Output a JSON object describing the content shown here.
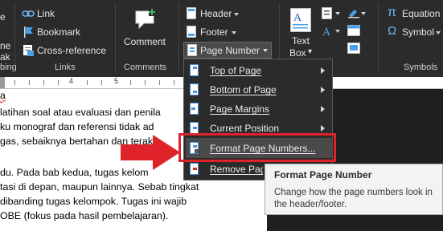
{
  "ribbon": {
    "links_group": {
      "items": [
        {
          "label": "Link",
          "icon": "link-icon"
        },
        {
          "label": "Bookmark",
          "icon": "bookmark-flag-icon"
        },
        {
          "label": "Cross-reference",
          "icon": "cross-reference-icon"
        }
      ],
      "group_label": "Links"
    },
    "comments_group": {
      "button_label": "Comment",
      "group_label": "Comments",
      "icon": "comment-icon"
    },
    "header_footer_group": {
      "header_label": "Header",
      "footer_label": "Footer",
      "page_number_label": "Page Number"
    },
    "text_group": {
      "text_box_label_line1": "Text",
      "text_box_label_line2": "Box",
      "caret": "▾"
    },
    "symbols_group": {
      "equation_label": "Equation",
      "symbol_label": "Symbol",
      "group_label": "Symbols",
      "equation_glyph": "π",
      "symbol_glyph": "Ω"
    },
    "left_cut_text": {
      "top": "e",
      "middle": "ne",
      "bottom": "ak"
    },
    "left_cut_label": "bing"
  },
  "ruler": {
    "marker_4": "4",
    "marker_5": "5"
  },
  "document": {
    "lines": [
      "a",
      "latihan soal atau evaluasi dan penila",
      "ku monograf dan referensi tidak ad",
      "gas, sebaiknya bertahan dan terak",
      "",
      "du. Pada bab kedua, tugas kelom",
      "tasi di depan, maupun lainnya. Sebab tingkat",
      "dibanding tugas kelompok. Tugas ini wajib",
      "OBE (fokus pada hasil pembelajaran)."
    ]
  },
  "page_number_menu": {
    "items": [
      {
        "label": "Top of Page",
        "has_submenu": true
      },
      {
        "label": "Bottom of Page",
        "has_submenu": true
      },
      {
        "label": "Page Margins",
        "has_submenu": true
      },
      {
        "label": "Current Position",
        "has_submenu": true
      },
      {
        "label": "Format Page Numbers...",
        "has_submenu": false,
        "highlighted": true
      },
      {
        "label": "Remove Page Numbers",
        "has_submenu": false
      }
    ]
  },
  "tooltip": {
    "title": "Format Page Number",
    "body": "Change how the page numbers look in the header/footer."
  },
  "colors": {
    "accent_blue": "#4aa0e8",
    "annotation_red": "#e0222a",
    "ribbon_bg": "#2b2b2b"
  }
}
